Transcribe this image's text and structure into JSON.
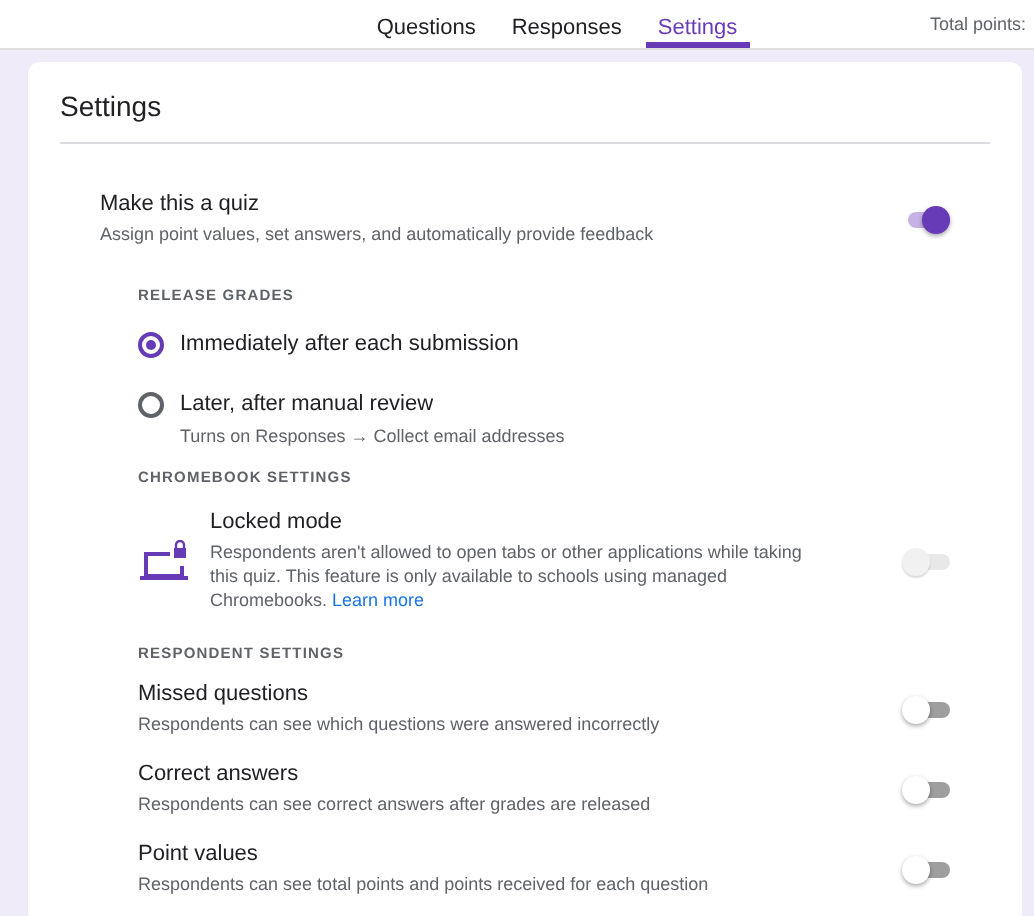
{
  "tabs": [
    {
      "label": "Questions",
      "selected": false
    },
    {
      "label": "Responses",
      "selected": false
    },
    {
      "label": "Settings",
      "selected": true
    }
  ],
  "total_points": "Total points:",
  "settings": {
    "title": "Settings",
    "quiz": {
      "title": "Make this a quiz",
      "description": "Assign point values, set answers, and automatically provide feedback",
      "on": true
    },
    "release_grades": {
      "heading": "RELEASE GRADES",
      "options": [
        {
          "label": "Immediately after each submission",
          "selected": true
        },
        {
          "label": "Later, after manual review",
          "note": "Turns on Responses → Collect email addresses",
          "selected": false
        }
      ]
    },
    "chromebook": {
      "heading": "CHROMEBOOK SETTINGS",
      "title": "Locked mode",
      "description": "Respondents aren't allowed to open tabs or other applications while taking this quiz. This feature is only available to schools using managed Chromebooks.",
      "link": "Learn more",
      "on": false,
      "disabled": true
    },
    "respondent": {
      "heading": "RESPONDENT SETTINGS",
      "items": [
        {
          "title": "Missed questions",
          "description": "Respondents can see which questions were answered incorrectly",
          "on": false
        },
        {
          "title": "Correct answers",
          "description": "Respondents can see correct answers after grades are released",
          "on": false
        },
        {
          "title": "Point values",
          "description": "Respondents can see total points and points received for each question",
          "on": false
        }
      ]
    }
  }
}
